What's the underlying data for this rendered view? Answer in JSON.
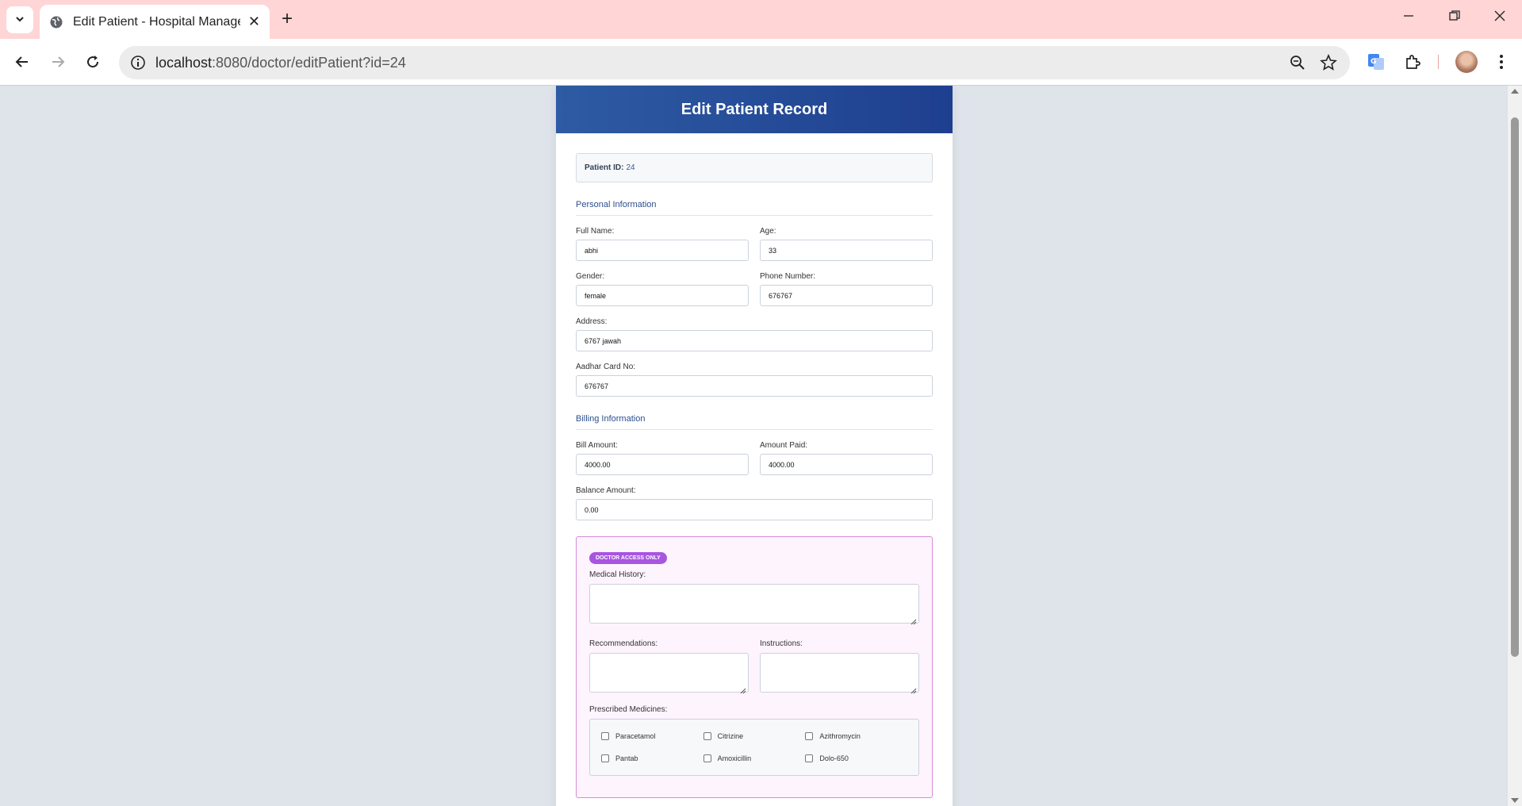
{
  "browser": {
    "tab_title": "Edit Patient - Hospital Managem",
    "url_host": "localhost",
    "url_path": ":8080/doctor/editPatient?id=24"
  },
  "page": {
    "header_title": "Edit Patient Record",
    "patient_id_label": "Patient ID:",
    "patient_id_value": "24"
  },
  "personal": {
    "section_title": "Personal Information",
    "full_name_label": "Full Name:",
    "full_name_value": "abhi",
    "age_label": "Age:",
    "age_value": "33",
    "gender_label": "Gender:",
    "gender_value": "female",
    "phone_label": "Phone Number:",
    "phone_value": "676767",
    "address_label": "Address:",
    "address_value": "6767 jawah",
    "aadhar_label": "Aadhar Card No:",
    "aadhar_value": "676767"
  },
  "billing": {
    "section_title": "Billing Information",
    "bill_label": "Bill Amount:",
    "bill_value": "4000.00",
    "paid_label": "Amount Paid:",
    "paid_value": "4000.00",
    "balance_label": "Balance Amount:",
    "balance_value": "0.00"
  },
  "doctor": {
    "badge": "DOCTOR ACCESS ONLY",
    "medical_history_label": "Medical History:",
    "recommendations_label": "Recommendations:",
    "instructions_label": "Instructions:",
    "prescribed_label": "Prescribed Medicines:",
    "medicines": [
      "Paracetamol",
      "Citrizine",
      "Azithromycin",
      "Pantab",
      "Amoxicillin",
      "Dolo-650"
    ]
  },
  "colors": {
    "header_gradient_start": "#2e5ba3",
    "header_gradient_end": "#1e3f8f",
    "badge": "#a855e0",
    "tabbar": "#ffd5d5"
  }
}
